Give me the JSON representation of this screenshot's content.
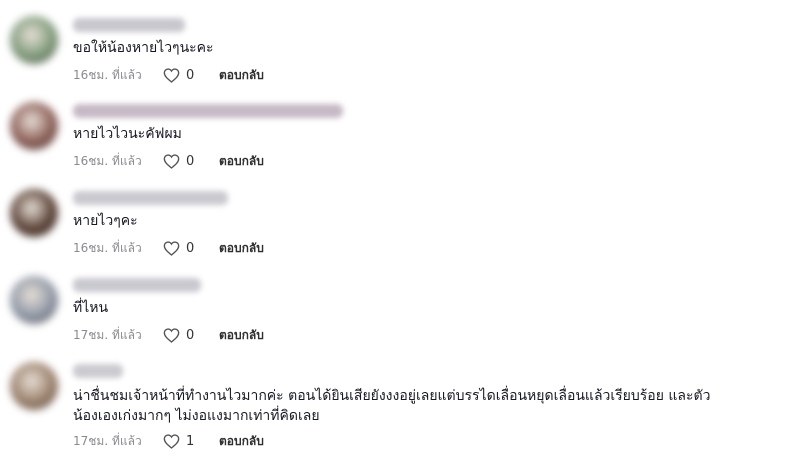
{
  "comments": [
    {
      "text": "ขอให้น้องหายไวๆนะคะ",
      "time": "16ชม. ที่แล้ว",
      "likes": "0",
      "reply": "ตอบกลับ",
      "avatar_color": "#7f9a7a",
      "username_color": "#c7c7ce"
    },
    {
      "text": "หายไวไวนะคัฟผม",
      "time": "16ชม. ที่แล้ว",
      "likes": "0",
      "reply": "ตอบกลับ",
      "avatar_color": "#8b5d56",
      "username_color": "#c6b9c4"
    },
    {
      "text": "หายไวๆคะ",
      "time": "16ชม. ที่แล้ว",
      "likes": "0",
      "reply": "ตอบกลับ",
      "avatar_color": "#5a4136",
      "username_color": "#c9c9cf"
    },
    {
      "text": "ที่ไหน",
      "time": "17ชม. ที่แล้ว",
      "likes": "0",
      "reply": "ตอบกลับ",
      "avatar_color": "#8f97a6",
      "username_color": "#c8c8cf"
    },
    {
      "text": "น่าชื่นชมเจ้าหน้าที่ทำงานไวมากค่ะ ตอนได้ยินเสียยังงงอยู่เลยแต่บรรไดเลื่อนหยุดเลื่อนแล้วเรียบร้อย และตัวน้องเองเก่งมากๆ ไม่งอแงมากเท่าที่คิดเลย",
      "time": "17ชม. ที่แล้ว",
      "likes": "1",
      "reply": "ตอบกลับ",
      "avatar_color": "#9a7f6a",
      "username_color": "#cacad0"
    }
  ]
}
